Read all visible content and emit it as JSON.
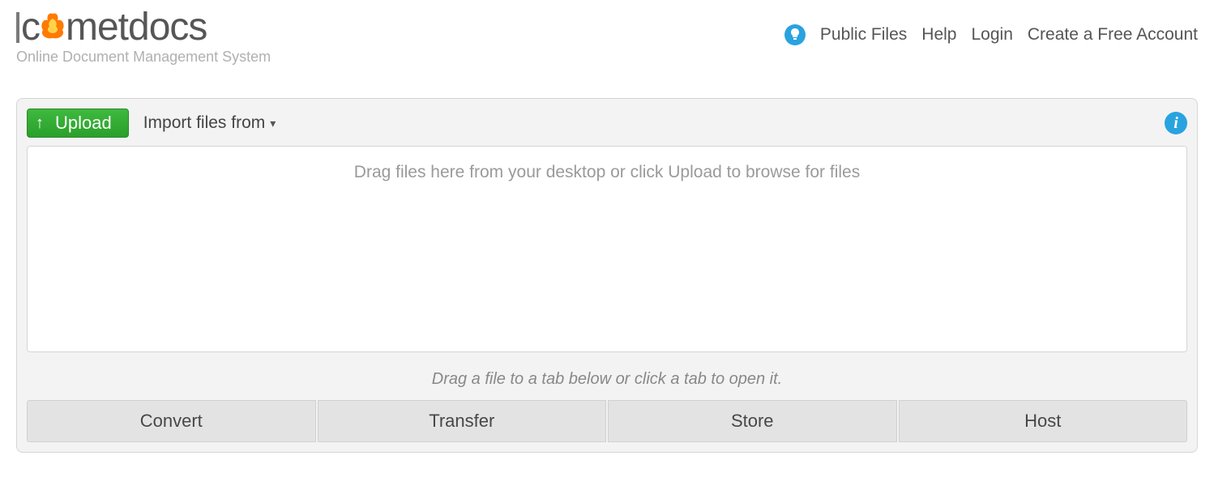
{
  "logo": {
    "name_prefix": "c",
    "name_suffix": "metdocs",
    "tagline": "Online Document Management System"
  },
  "nav": {
    "public_files": "Public Files",
    "help": "Help",
    "login": "Login",
    "create_account": "Create a Free Account"
  },
  "toolbar": {
    "upload_label": "Upload",
    "import_label": "Import files from"
  },
  "dropzone": {
    "placeholder": "Drag files here from your desktop or click Upload to browse for files"
  },
  "hint": "Drag a file to a tab below or click a tab to open it.",
  "tabs": [
    "Convert",
    "Transfer",
    "Store",
    "Host"
  ]
}
